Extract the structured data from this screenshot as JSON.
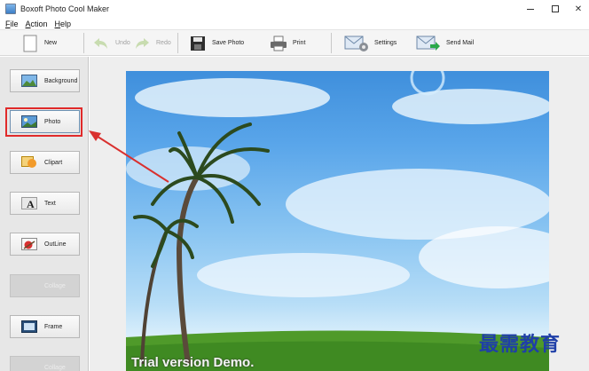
{
  "window": {
    "title": "Boxoft Photo Cool Maker"
  },
  "menu": {
    "items": [
      {
        "first": "F",
        "rest": "ile"
      },
      {
        "first": "A",
        "rest": "ction"
      },
      {
        "first": "H",
        "rest": "elp"
      }
    ]
  },
  "toolbar": {
    "new_label": "New",
    "undo_label": "Undo",
    "redo_label": "Redo",
    "save_label": "Save Photo",
    "print_label": "Print",
    "settings_label": "Settings",
    "sendmail_label": "Send Mail"
  },
  "tools": [
    {
      "label": "Background",
      "enabled": true
    },
    {
      "label": "Photo",
      "enabled": true,
      "selected": true
    },
    {
      "label": "Clipart",
      "enabled": true
    },
    {
      "label": "Text",
      "enabled": true
    },
    {
      "label": "OutLine",
      "enabled": true
    },
    {
      "label": "Collage",
      "enabled": false
    },
    {
      "label": "Frame",
      "enabled": true
    },
    {
      "label": "Collage",
      "enabled": false
    }
  ],
  "canvas": {
    "overlay_text": "Trial version Demo."
  },
  "watermark": {
    "text": "最需教育"
  },
  "colors": {
    "highlight": "#e02a2a",
    "sky": "#5aa6ea",
    "grass": "#4f9a2a",
    "watermark": "#1f3fa8"
  }
}
